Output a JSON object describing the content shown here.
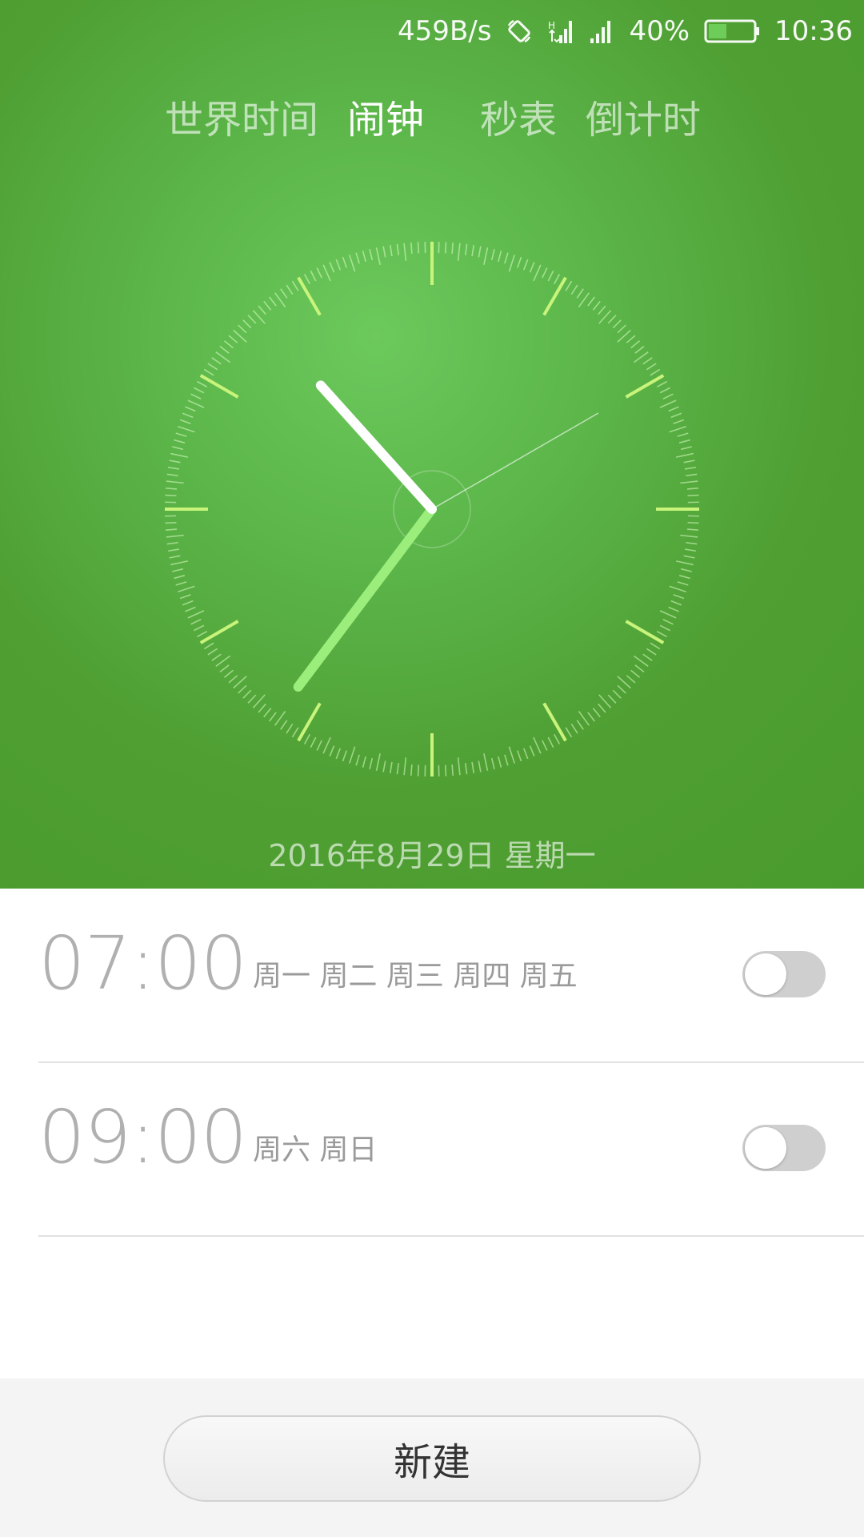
{
  "status_bar": {
    "net_speed": "459B/s",
    "battery_percent": "40%",
    "battery_level": 0.4,
    "time": "10:36",
    "icons": [
      "rotate-icon",
      "data-signal-icon",
      "cell-signal-icon",
      "battery-icon"
    ]
  },
  "tabs": [
    {
      "label": "世界时间",
      "active": false
    },
    {
      "label": "闹钟",
      "active": true
    },
    {
      "label": "秒表",
      "active": false
    },
    {
      "label": "倒计时",
      "active": false
    }
  ],
  "clock": {
    "time_shown": "10:36",
    "second_hand": 10,
    "colors": {
      "hour_hand": "#ffffff",
      "minute_hand": "#9cee7c",
      "ticks": "#c9f47b"
    }
  },
  "date": "2016年8月29日  星期一",
  "alarms": [
    {
      "time": "07:00",
      "days": "周一 周二 周三 周四 周五",
      "enabled": false
    },
    {
      "time": "09:00",
      "days": "周六 周日",
      "enabled": false
    }
  ],
  "new_button_label": "新建",
  "colors": {
    "accent": "#5cb64a",
    "toggle_off": "#cfcfcf"
  }
}
